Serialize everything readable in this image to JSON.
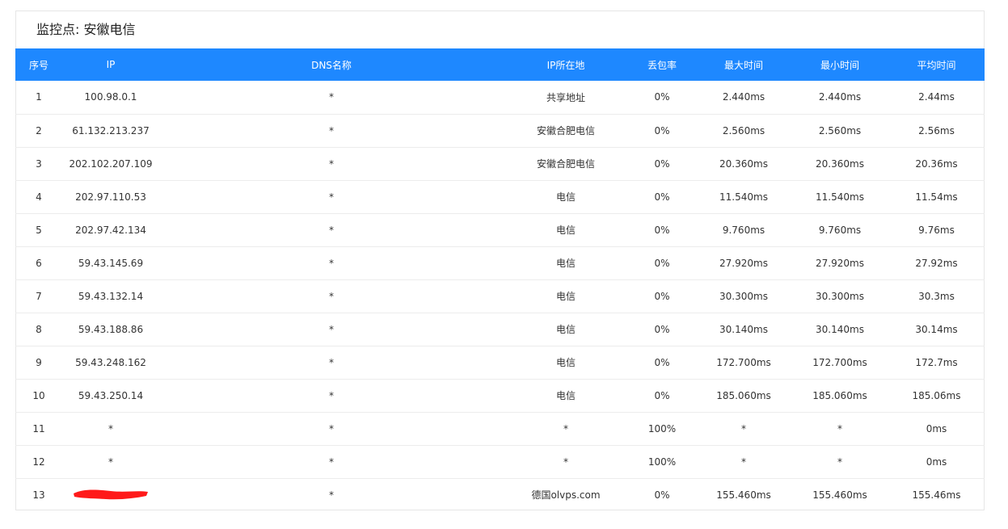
{
  "panel": {
    "title": "监控点: 安徽电信"
  },
  "table": {
    "headers": [
      "序号",
      "IP",
      "DNS名称",
      "IP所在地",
      "丢包率",
      "最大时间",
      "最小时间",
      "平均时间"
    ],
    "rows": [
      [
        "1",
        "100.98.0.1",
        "*",
        "共享地址",
        "0%",
        "2.440ms",
        "2.440ms",
        "2.44ms"
      ],
      [
        "2",
        "61.132.213.237",
        "*",
        "安徽合肥电信",
        "0%",
        "2.560ms",
        "2.560ms",
        "2.56ms"
      ],
      [
        "3",
        "202.102.207.109",
        "*",
        "安徽合肥电信",
        "0%",
        "20.360ms",
        "20.360ms",
        "20.36ms"
      ],
      [
        "4",
        "202.97.110.53",
        "*",
        "电信",
        "0%",
        "11.540ms",
        "11.540ms",
        "11.54ms"
      ],
      [
        "5",
        "202.97.42.134",
        "*",
        "电信",
        "0%",
        "9.760ms",
        "9.760ms",
        "9.76ms"
      ],
      [
        "6",
        "59.43.145.69",
        "*",
        "电信",
        "0%",
        "27.920ms",
        "27.920ms",
        "27.92ms"
      ],
      [
        "7",
        "59.43.132.14",
        "*",
        "电信",
        "0%",
        "30.300ms",
        "30.300ms",
        "30.3ms"
      ],
      [
        "8",
        "59.43.188.86",
        "*",
        "电信",
        "0%",
        "30.140ms",
        "30.140ms",
        "30.14ms"
      ],
      [
        "9",
        "59.43.248.162",
        "*",
        "电信",
        "0%",
        "172.700ms",
        "172.700ms",
        "172.7ms"
      ],
      [
        "10",
        "59.43.250.14",
        "*",
        "电信",
        "0%",
        "185.060ms",
        "185.060ms",
        "185.06ms"
      ],
      [
        "11",
        "*",
        "*",
        "*",
        "100%",
        "*",
        "*",
        "0ms"
      ],
      [
        "12",
        "*",
        "*",
        "*",
        "100%",
        "*",
        "*",
        "0ms"
      ],
      [
        "13",
        "",
        "*",
        "德国olvps.com",
        "0%",
        "155.460ms",
        "155.460ms",
        "155.46ms"
      ]
    ]
  },
  "colors": {
    "header_bg": "#1e88ff",
    "redaction": "#ff1a1a"
  }
}
